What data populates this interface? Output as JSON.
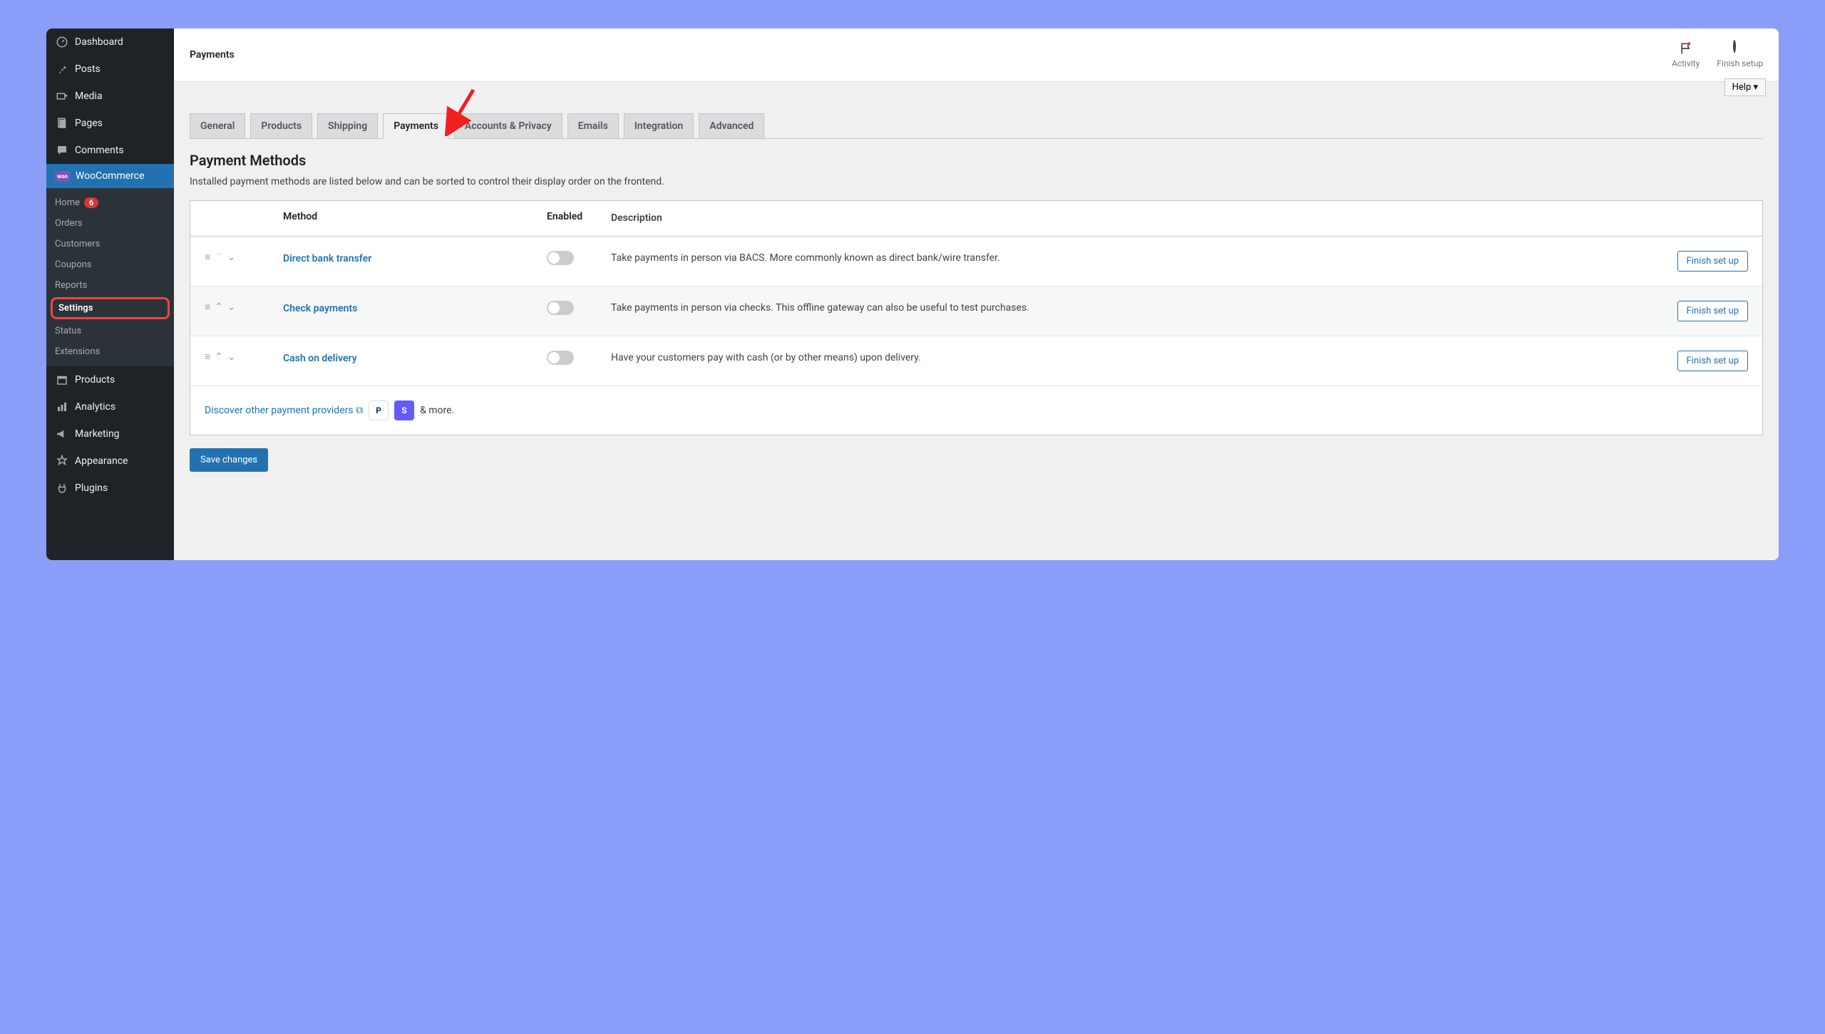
{
  "sidebar": {
    "items": [
      {
        "label": "Dashboard",
        "icon": "dashboard"
      },
      {
        "label": "Posts",
        "icon": "pin"
      },
      {
        "label": "Media",
        "icon": "media"
      },
      {
        "label": "Pages",
        "icon": "pages"
      },
      {
        "label": "Comments",
        "icon": "comments"
      },
      {
        "label": "WooCommerce",
        "icon": "woo"
      },
      {
        "label": "Products",
        "icon": "products"
      },
      {
        "label": "Analytics",
        "icon": "analytics"
      },
      {
        "label": "Marketing",
        "icon": "marketing"
      },
      {
        "label": "Appearance",
        "icon": "appearance"
      },
      {
        "label": "Plugins",
        "icon": "plugins"
      }
    ],
    "submenu": {
      "home": {
        "label": "Home",
        "badge": "6"
      },
      "orders": "Orders",
      "customers": "Customers",
      "coupons": "Coupons",
      "reports": "Reports",
      "settings": "Settings",
      "status": "Status",
      "extensions": "Extensions"
    }
  },
  "topbar": {
    "title": "Payments",
    "activity": "Activity",
    "finish_setup": "Finish setup"
  },
  "help_label": "Help ▾",
  "tabs": [
    "General",
    "Products",
    "Shipping",
    "Payments",
    "Accounts & Privacy",
    "Emails",
    "Integration",
    "Advanced"
  ],
  "active_tab_index": 3,
  "section": {
    "title": "Payment Methods",
    "description": "Installed payment methods are listed below and can be sorted to control their display order on the frontend."
  },
  "table": {
    "headers": {
      "method": "Method",
      "enabled": "Enabled",
      "description": "Description"
    },
    "rows": [
      {
        "method": "Direct bank transfer",
        "enabled": false,
        "description": "Take payments in person via BACS. More commonly known as direct bank/wire transfer.",
        "action": "Finish set up"
      },
      {
        "method": "Check payments",
        "enabled": false,
        "description": "Take payments in person via checks. This offline gateway can also be useful to test purchases.",
        "action": "Finish set up"
      },
      {
        "method": "Cash on delivery",
        "enabled": false,
        "description": "Have your customers pay with cash (or by other means) upon delivery.",
        "action": "Finish set up"
      }
    ],
    "footer": {
      "link": "Discover other payment providers",
      "more": "& more."
    }
  },
  "save_label": "Save changes"
}
